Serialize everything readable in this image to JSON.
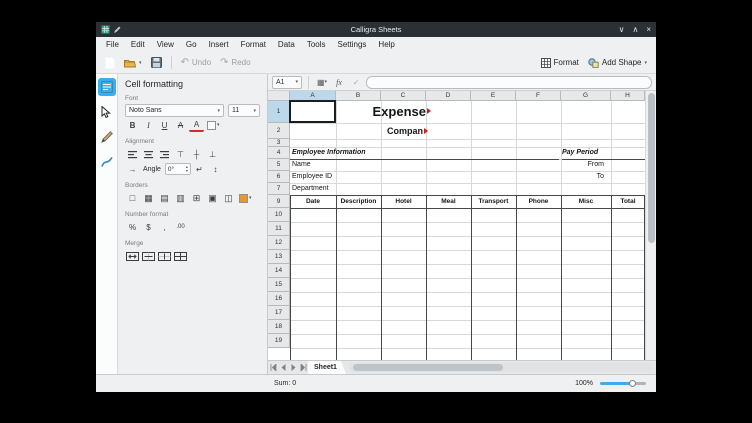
{
  "titlebar": {
    "title": "Calligra Sheets"
  },
  "menu": {
    "items": [
      "File",
      "Edit",
      "View",
      "Go",
      "Insert",
      "Format",
      "Data",
      "Tools",
      "Settings",
      "Help"
    ]
  },
  "toolbar": {
    "undo": "Undo",
    "redo": "Redo",
    "format": "Format",
    "add_shape": "Add Shape"
  },
  "panel": {
    "title": "Cell formatting",
    "sections": {
      "font": "Font",
      "alignment": "Alignment",
      "borders": "Borders",
      "number": "Number format",
      "merge": "Merge"
    },
    "font_family": "Noto Sans",
    "font_size": "11",
    "buttons": {
      "bold": "B",
      "italic": "I",
      "underline": "U",
      "strikethrough": "A",
      "text_color": "A"
    },
    "angle_label": "Angle",
    "angle_value": "0°",
    "number_buttons": {
      "percent": "%",
      "currency": "$",
      "comma": ",",
      "precision": ".00"
    }
  },
  "formula_bar": {
    "cell_ref": "A1",
    "fx": "fx",
    "apply": "✓"
  },
  "grid": {
    "columns": [
      "A",
      "B",
      "C",
      "D",
      "E",
      "F",
      "G",
      "H"
    ],
    "rows": [
      "1",
      "2",
      "3",
      "4",
      "5",
      "6",
      "7",
      "9",
      "10",
      "11",
      "12",
      "13",
      "14",
      "15",
      "16",
      "17",
      "18",
      "19"
    ],
    "cells": {
      "title": "Expense",
      "subtitle": "Compan",
      "employee_info": "Employee Information",
      "pay_period": "Pay Period",
      "name": "Name",
      "from": "From",
      "employee_id": "Employee ID",
      "to": "To",
      "department": "Department"
    },
    "table_headers": [
      "Date",
      "Description",
      "Hotel",
      "Meal",
      "Transport",
      "Phone",
      "Misc",
      "Total"
    ]
  },
  "tabs": {
    "sheet": "Sheet1"
  },
  "status": {
    "sum": "Sum: 0",
    "zoom": "100%"
  },
  "colors": {
    "accent": "#3daee9",
    "titlebar": "#2b3035",
    "selection_header": "#bed8eb",
    "overflow_marker": "#cc1d1d",
    "border_swatch": "#e09a35"
  }
}
